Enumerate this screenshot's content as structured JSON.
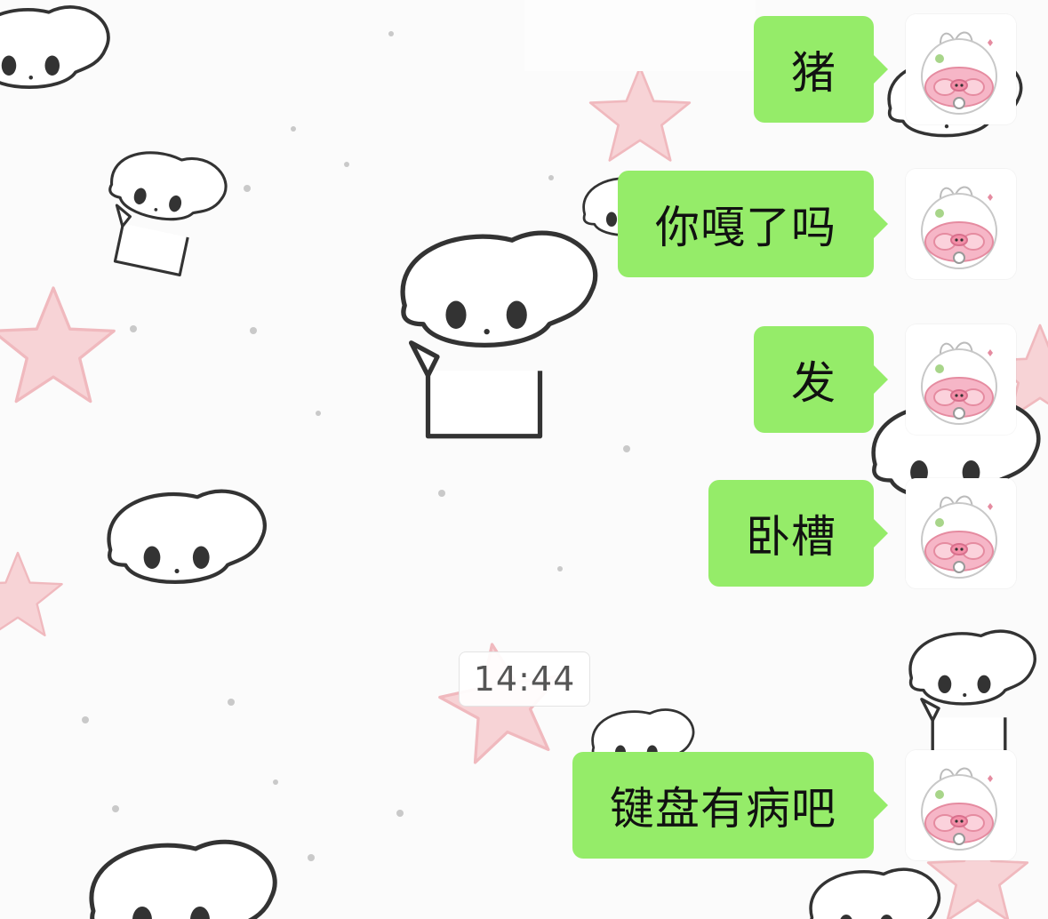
{
  "chat": {
    "messages": [
      {
        "text": "猪",
        "sender": "self"
      },
      {
        "text": "你嘎了吗",
        "sender": "self"
      },
      {
        "text": "发",
        "sender": "self"
      },
      {
        "text": "卧槽",
        "sender": "self"
      },
      {
        "text": "键盘有病吧",
        "sender": "self"
      }
    ],
    "timestamp": "14:44"
  },
  "colors": {
    "bubble_self": "#95ec69",
    "background": "#fbfbfb",
    "timestamp_text": "#555555"
  },
  "icons": {
    "avatar": "pig-bunny-avatar-icon",
    "background_doodles": [
      "puppy-doodle-icon",
      "star-doodle-icon"
    ]
  }
}
